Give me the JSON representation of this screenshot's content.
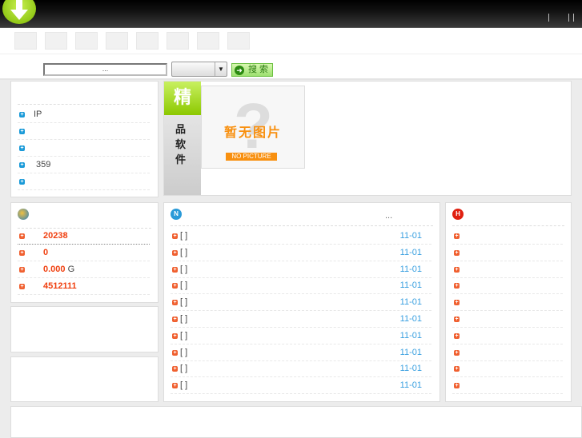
{
  "header": {
    "logo": "download-arrow-logo"
  },
  "nav": {
    "items": 8
  },
  "search": {
    "input_value": "...",
    "select_value": "",
    "button_label": "搜 索"
  },
  "left_panel": {
    "items": [
      "IP",
      "",
      "",
      "359",
      ""
    ]
  },
  "featured": {
    "badge": "精",
    "vertical_text": [
      "品",
      "软",
      "件"
    ],
    "placeholder_cn": "暂无图片",
    "placeholder_en": "NO PICTURE"
  },
  "stats": {
    "icon": "globe-icon",
    "items": [
      {
        "value": "20238",
        "unit": ""
      },
      {
        "value": "0",
        "unit": ""
      },
      {
        "value": "0.000",
        "unit": "G"
      },
      {
        "value": "4512111",
        "unit": ""
      }
    ]
  },
  "news": {
    "icon": "n-badge-icon",
    "more": "...",
    "items": [
      {
        "title": "[ ]",
        "date": "11-01"
      },
      {
        "title": "[ ]",
        "date": "11-01"
      },
      {
        "title": "[ ]",
        "date": "11-01"
      },
      {
        "title": "[ ]",
        "date": "11-01"
      },
      {
        "title": "[ ]",
        "date": "11-01"
      },
      {
        "title": "[ ]",
        "date": "11-01"
      },
      {
        "title": "[ ]",
        "date": "11-01"
      },
      {
        "title": "[ ]",
        "date": "11-01"
      },
      {
        "title": "[ ]",
        "date": "11-01"
      },
      {
        "title": "[ ]",
        "date": "11-01"
      }
    ]
  },
  "hot": {
    "icon": "h-badge-icon",
    "count": 10
  },
  "colors": {
    "accent_red": "#f04010",
    "date_blue": "#3aa0e0",
    "logo_green": "#8cc800"
  }
}
